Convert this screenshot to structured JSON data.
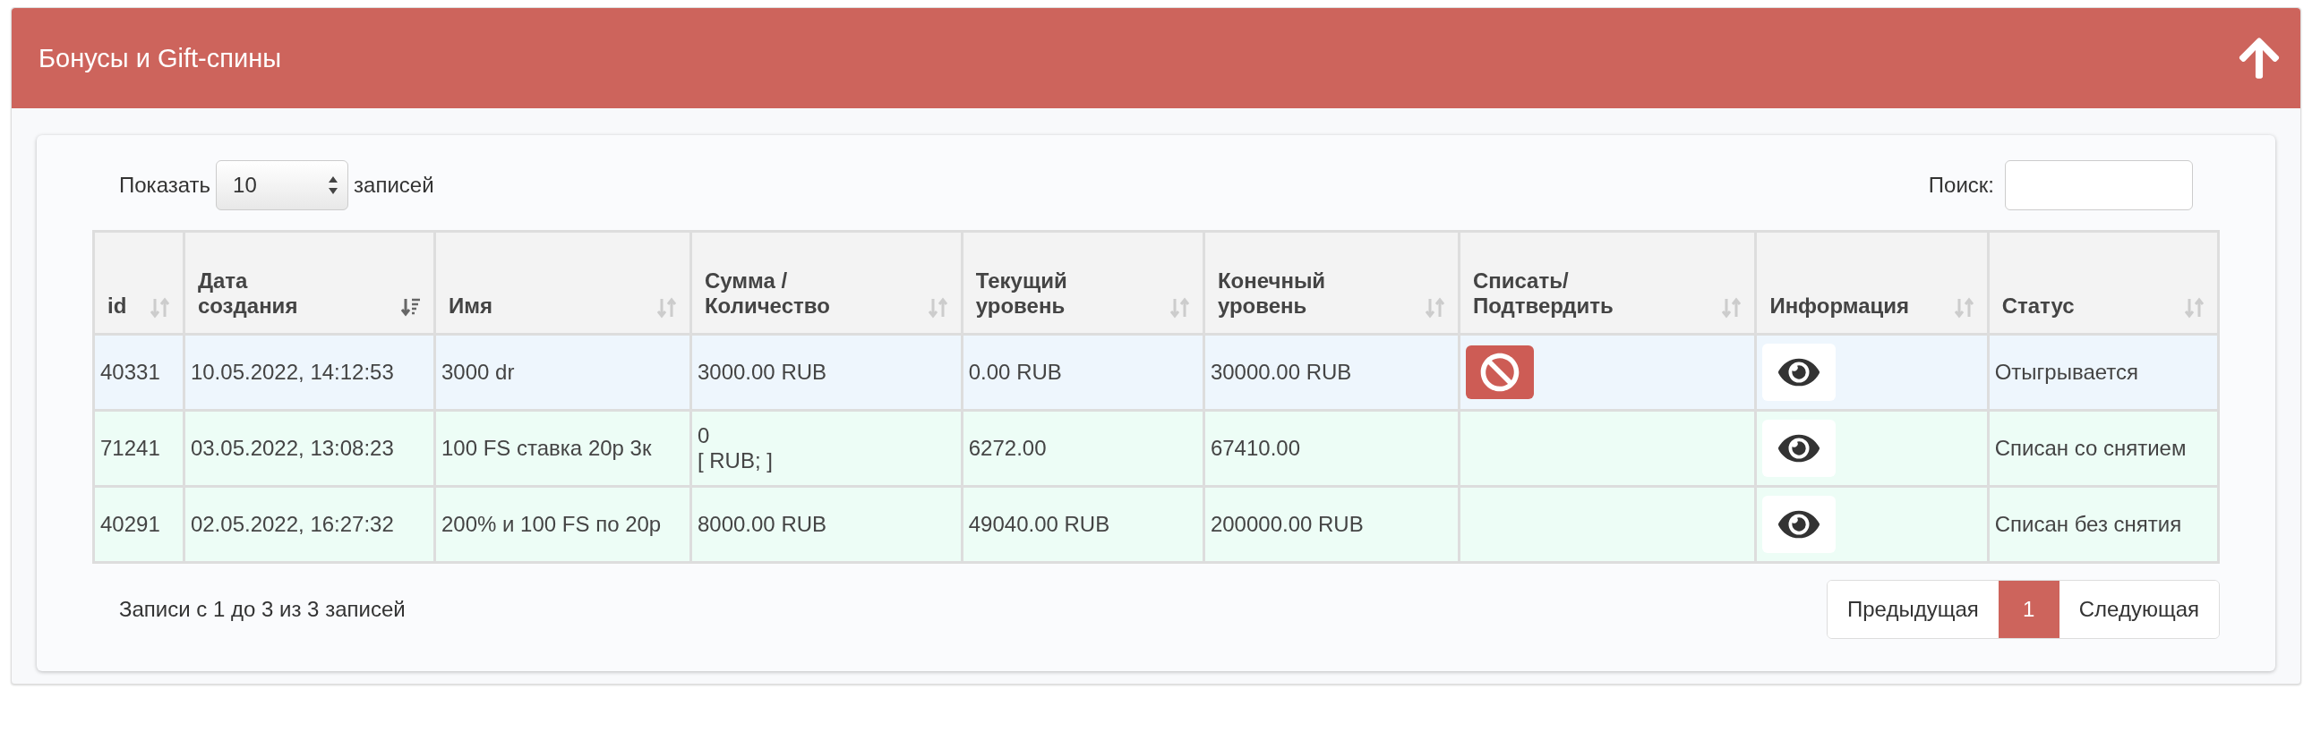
{
  "panel": {
    "title": "Бонусы и Gift-спины"
  },
  "length_menu": {
    "before": "Показать",
    "value": "10",
    "after": "записей"
  },
  "search": {
    "label": "Поиск:"
  },
  "table": {
    "columns": [
      {
        "label": "id",
        "sorted": false
      },
      {
        "label": "Дата создания",
        "sorted": true
      },
      {
        "label": "Имя",
        "sorted": false
      },
      {
        "label": "Сумма / Количество",
        "sorted": false
      },
      {
        "label": "Текущий уровень",
        "sorted": false
      },
      {
        "label": "Конечный уровень",
        "sorted": false
      },
      {
        "label": "Списать/ Подтвердить",
        "sorted": false
      },
      {
        "label": "Информация",
        "sorted": false
      },
      {
        "label": "Статус",
        "sorted": false
      }
    ],
    "rows": [
      {
        "color": "#eef6fd",
        "id": "40331",
        "date": "10.05.2022, 14:12:53",
        "name": "3000 dr",
        "amount": [
          "3000.00 RUB"
        ],
        "current": "0.00 RUB",
        "final": "30000.00 RUB",
        "cancel_button": true,
        "status": "Отыгрывается"
      },
      {
        "color": "#edfdf6",
        "id": "71241",
        "date": "03.05.2022, 13:08:23",
        "name": "100 FS ставка 20р 3к",
        "amount": [
          "0",
          "[ RUB; ]"
        ],
        "current": "6272.00",
        "final": "67410.00",
        "cancel_button": false,
        "status": "Списан со снятием"
      },
      {
        "color": "#edfdf6",
        "id": "40291",
        "date": "02.05.2022, 16:27:32",
        "name": "200% и 100 FS по 20р",
        "amount": [
          "8000.00 RUB"
        ],
        "current": "49040.00 RUB",
        "final": "200000.00 RUB",
        "cancel_button": false,
        "status": "Списан без снятия"
      }
    ]
  },
  "info": "Записи с 1 до 3 из 3 записей",
  "pagination": {
    "previous": "Предыдущая",
    "pages": [
      {
        "label": "1",
        "selected": true
      }
    ],
    "next": "Следующая"
  }
}
